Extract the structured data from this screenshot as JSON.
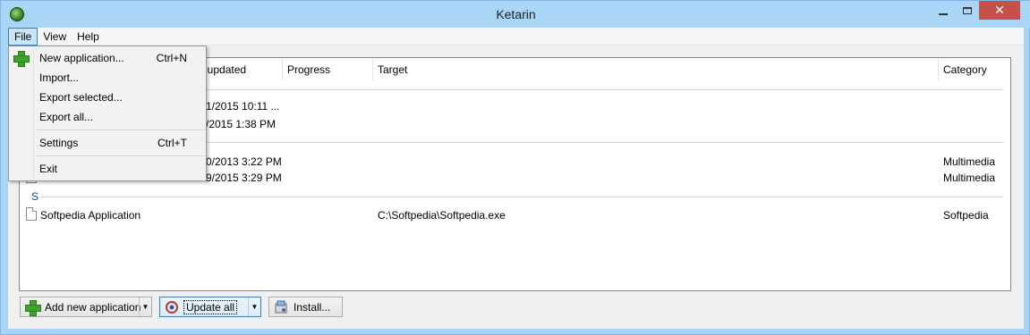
{
  "window": {
    "title": "Ketarin",
    "minimize_glyph": "—",
    "close_glyph": "✕"
  },
  "menubar": {
    "file": "File",
    "view": "View",
    "help": "Help"
  },
  "file_menu": {
    "new_application": "New application...",
    "new_application_shortcut": "Ctrl+N",
    "import": "Import...",
    "export_selected": "Export selected...",
    "export_all": "Export all...",
    "settings": "Settings",
    "settings_shortcut": "Ctrl+T",
    "exit": "Exit"
  },
  "list": {
    "columns": {
      "last_updated": "t updated",
      "progress": "Progress",
      "target": "Target",
      "category": "Category"
    },
    "group_s": "S",
    "rows": [
      {
        "last_updated": "1/2015 10:11 ...",
        "target": "",
        "category": ""
      },
      {
        "last_updated": "/2015 1:38 PM",
        "target": "",
        "category": ""
      },
      {
        "last_updated": "0/2013 3:22 PM",
        "target": "",
        "category": "Multimedia"
      },
      {
        "last_updated": "9/2015 3:29 PM",
        "target": "",
        "category": "Multimedia"
      },
      {
        "name": "Softpedia Application",
        "last_updated": "",
        "target": "C:\\Softpedia\\Softpedia.exe",
        "category": "Softpedia"
      }
    ]
  },
  "buttons": {
    "add_new": "Add new application",
    "update_all": "Update all",
    "install": "Install..."
  },
  "icons": {
    "app": "ketarin-icon",
    "add": "plus-icon",
    "update": "update-icon",
    "install": "install-icon"
  },
  "colors": {
    "titlebar": "#a9d5f7",
    "close_button": "#c7504a",
    "group_header": "#1e3d8f",
    "add_plus": "#3fa42b"
  }
}
